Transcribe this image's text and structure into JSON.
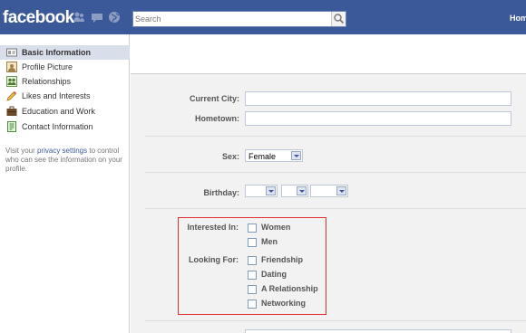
{
  "header": {
    "logo": "facebook",
    "search_placeholder": "Search",
    "home_label": "Home",
    "colors": {
      "bar": "#3b5998"
    },
    "icons": [
      "friend-requests-icon",
      "messages-icon",
      "notifications-globe-icon",
      "search-magnifier-icon"
    ]
  },
  "sidebar": {
    "items": [
      {
        "label": "Basic Information",
        "icon": "id-card-icon"
      },
      {
        "label": "Profile Picture",
        "icon": "picture-frame-icon"
      },
      {
        "label": "Relationships",
        "icon": "people-icon"
      },
      {
        "label": "Likes and Interests",
        "icon": "pencil-icon"
      },
      {
        "label": "Education and Work",
        "icon": "briefcase-icon"
      },
      {
        "label": "Contact Information",
        "icon": "contact-card-icon"
      }
    ],
    "note_prefix": "Visit your ",
    "note_link": "privacy settings",
    "note_suffix": " to control who can see the information on your profile."
  },
  "form": {
    "current_city_label": "Current City:",
    "current_city_value": "",
    "hometown_label": "Hometown:",
    "hometown_value": "",
    "sex_label": "Sex:",
    "sex_value": "Female",
    "birthday_label": "Birthday:",
    "interested_in_label": "Interested In:",
    "interested_in_options": [
      "Women",
      "Men"
    ],
    "looking_for_label": "Looking For:",
    "looking_for_options": [
      "Friendship",
      "Dating",
      "A Relationship",
      "Networking"
    ],
    "highlight_color": "#e03030"
  }
}
